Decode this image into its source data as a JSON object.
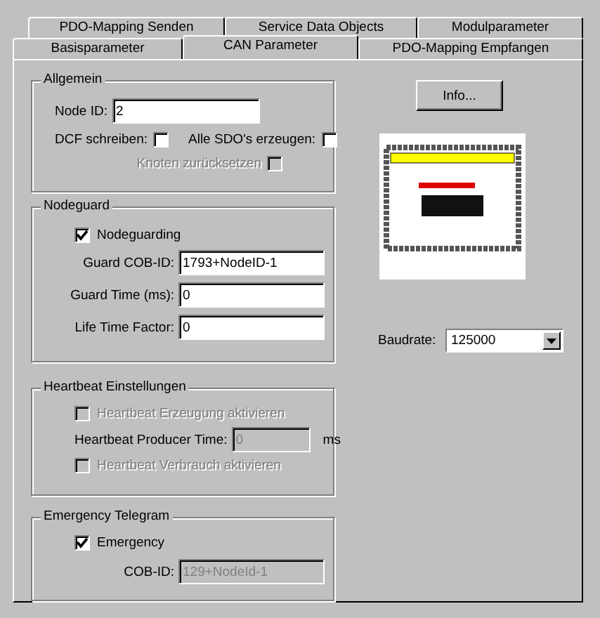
{
  "tabs_back_row": [
    {
      "label": "PDO-Mapping Senden",
      "selected": false
    },
    {
      "label": "Service Data Objects",
      "selected": false
    },
    {
      "label": "Modulparameter",
      "selected": false
    }
  ],
  "tabs_front_row": [
    {
      "label": "Basisparameter",
      "selected": false
    },
    {
      "label": "CAN Parameter",
      "selected": true
    },
    {
      "label": "PDO-Mapping Empfangen",
      "selected": false
    }
  ],
  "general": {
    "title": "Allgemein",
    "node_id": {
      "label": "Node ID:",
      "value": "2"
    },
    "checkboxes": [
      {
        "label": "DCF schreiben:",
        "checked": false,
        "disabled": false
      },
      {
        "label": "Alle SDO's erzeugen:",
        "checked": false,
        "disabled": false
      },
      {
        "label": "Knoten zurücksetzen",
        "checked": false,
        "disabled": true
      }
    ]
  },
  "nodeguard": {
    "title": "Nodeguard",
    "checkbox": {
      "label": "Nodeguarding",
      "checked": true,
      "disabled": false
    },
    "fields": [
      {
        "label": "Guard COB-ID:",
        "value": "1793+NodeID-1",
        "disabled": false
      },
      {
        "label": "Guard Time (ms):",
        "value": "0",
        "disabled": false
      },
      {
        "label": "Life Time Factor:",
        "value": "0",
        "disabled": false
      }
    ]
  },
  "heartbeat": {
    "title": "Heartbeat Einstellungen",
    "producer_checkbox": {
      "label": "Heartbeat Erzeugung aktivieren",
      "checked": false,
      "disabled": true
    },
    "producer_time": {
      "label": "Heartbeat Producer Time:",
      "value": "0",
      "unit": "ms",
      "disabled": true
    },
    "consumer_checkbox": {
      "label": "Heartbeat Verbrauch aktivieren",
      "checked": false,
      "disabled": true
    }
  },
  "emergency": {
    "title": "Emergency Telegram",
    "checkbox": {
      "label": "Emergency",
      "checked": true,
      "disabled": false
    },
    "field": {
      "label": "COB-ID:",
      "value": "129+NodeId-1",
      "disabled": true
    }
  },
  "info_button": "Info...",
  "baudrate": {
    "label": "Baudrate:",
    "value": "125000"
  }
}
